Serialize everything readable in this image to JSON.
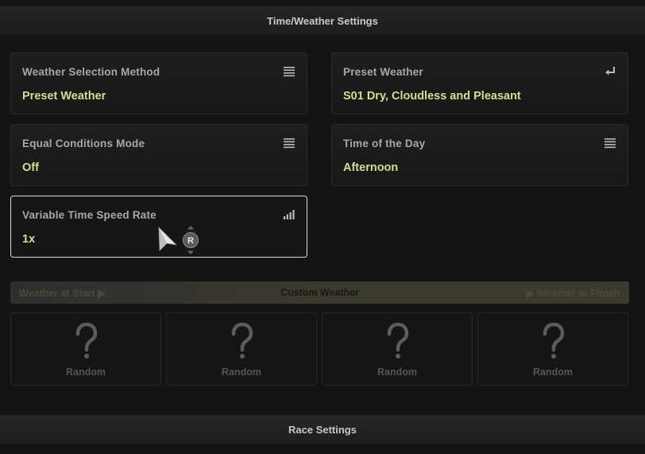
{
  "header": {
    "title": "Time/Weather Settings"
  },
  "settings": {
    "weather_method": {
      "label": "Weather Selection Method",
      "value": "Preset Weather",
      "icon": "list-icon"
    },
    "preset_weather": {
      "label": "Preset Weather",
      "value": "S01 Dry, Cloudless and Pleasant",
      "icon": "enter-icon"
    },
    "equal_conditions": {
      "label": "Equal Conditions Mode",
      "value": "Off",
      "icon": "list-icon"
    },
    "time_of_day": {
      "label": "Time of the Day",
      "value": "Afternoon",
      "icon": "list-icon"
    },
    "time_speed": {
      "label": "Variable Time Speed Rate",
      "value": "1x",
      "icon": "signal-bars-icon"
    }
  },
  "controller_hint": {
    "button": "R"
  },
  "weather_bar": {
    "start_label": "Weather at Start",
    "title": "Custom Weather",
    "finish_label": "Weather at Finish"
  },
  "weather_slots": [
    {
      "label": "Random",
      "icon": "question-mark-icon"
    },
    {
      "label": "Random",
      "icon": "question-mark-icon"
    },
    {
      "label": "Random",
      "icon": "question-mark-icon"
    },
    {
      "label": "Random",
      "icon": "question-mark-icon"
    }
  ],
  "footer": {
    "title": "Race Settings"
  },
  "colors": {
    "value_text": "#d6dd92",
    "label_text": "#a8a8a8",
    "background": "#141414"
  }
}
